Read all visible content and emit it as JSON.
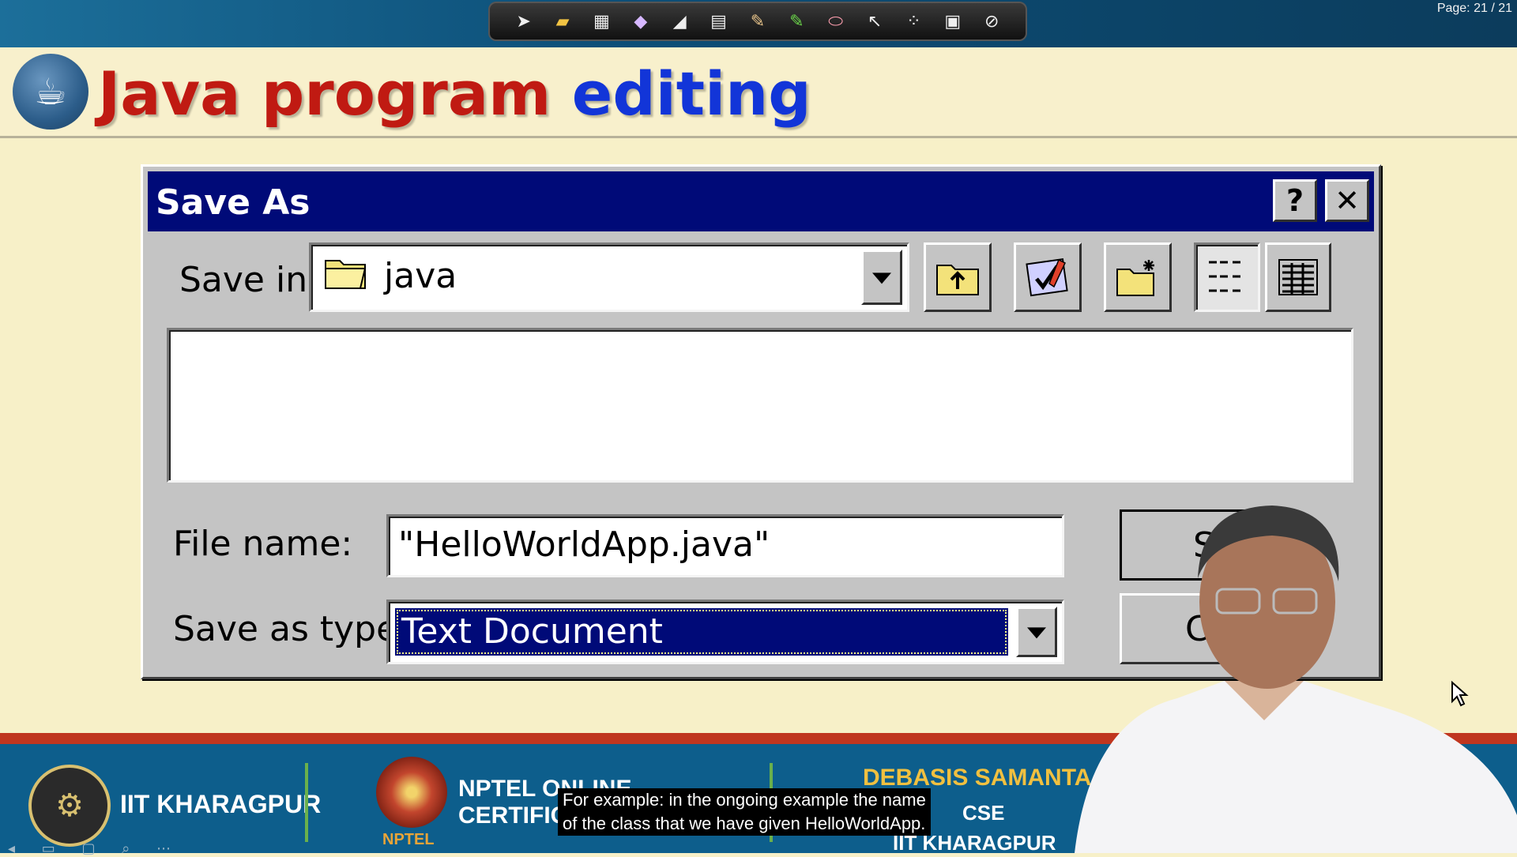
{
  "top_toolbar": {
    "page_counter": "Page: 21 / 21",
    "tools": [
      "arrow-tool",
      "folder-tool",
      "film-tool",
      "highlighter-tool",
      "eraser-tool",
      "screen-tool",
      "pencil-tool",
      "green-marker-tool",
      "pink-eraser-tool",
      "pointer-tool",
      "laser-tool",
      "clear-tool",
      "disable-tool"
    ]
  },
  "slide": {
    "title_part1": "Java program",
    "title_part2": "editing",
    "title_color_1": "#c01a12",
    "title_color_2": "#1235d8"
  },
  "dialog": {
    "title": "Save As",
    "help_label": "?",
    "close_label": "✕",
    "save_in_label": "Save in:",
    "save_in_value": "java",
    "file_name_label": "File name:",
    "file_name_value": "\"HelloWorldApp.java\"",
    "save_type_label": "Save as type:",
    "save_type_value": "Text Document",
    "save_button_label": "S",
    "cancel_button_label": "C",
    "titlebar_color": "#000a78"
  },
  "footer": {
    "institute": "IIT KHARAGPUR",
    "nptel_line1": "NPTEL ONLINE",
    "nptel_line2": "CERTIFIC",
    "nptel_small": "NPTEL",
    "presenter_name": "DEBASIS SAMANTA",
    "presenter_dept": "CSE",
    "presenter_inst": "IIT KHARAGPUR",
    "accent_bar": "#c0361f",
    "bg": "#0d5e8c"
  },
  "caption": {
    "line1": "For example: in the ongoing example the name",
    "line2": "of the class that we have given HelloWorldApp."
  }
}
